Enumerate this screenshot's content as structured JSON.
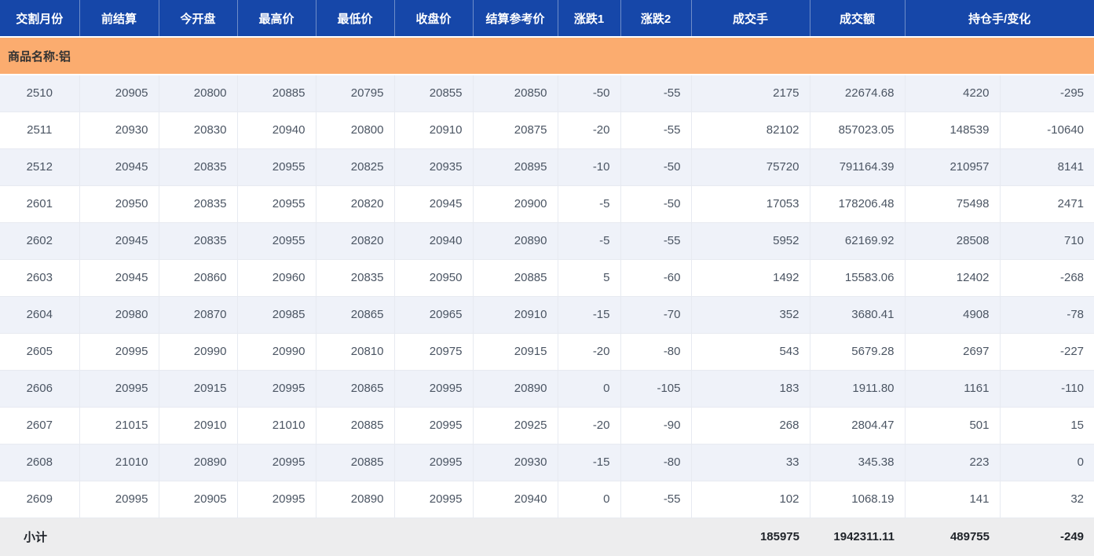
{
  "table": {
    "group_label": "商品名称:铝",
    "columns": [
      {
        "key": "month",
        "label": "交割月份"
      },
      {
        "key": "prev_settle",
        "label": "前结算"
      },
      {
        "key": "open",
        "label": "今开盘"
      },
      {
        "key": "high",
        "label": "最高价"
      },
      {
        "key": "low",
        "label": "最低价"
      },
      {
        "key": "close",
        "label": "收盘价"
      },
      {
        "key": "settle_ref",
        "label": "结算参考价"
      },
      {
        "key": "change1",
        "label": "涨跌1"
      },
      {
        "key": "change2",
        "label": "涨跌2"
      },
      {
        "key": "volume",
        "label": "成交手"
      },
      {
        "key": "turnover",
        "label": "成交额"
      },
      {
        "key": "oi_and_change",
        "label": "持仓手/变化",
        "span": 2
      }
    ],
    "rows": [
      [
        "2510",
        "20905",
        "20800",
        "20885",
        "20795",
        "20855",
        "20850",
        "-50",
        "-55",
        "2175",
        "22674.68",
        "4220",
        "-295"
      ],
      [
        "2511",
        "20930",
        "20830",
        "20940",
        "20800",
        "20910",
        "20875",
        "-20",
        "-55",
        "82102",
        "857023.05",
        "148539",
        "-10640"
      ],
      [
        "2512",
        "20945",
        "20835",
        "20955",
        "20825",
        "20935",
        "20895",
        "-10",
        "-50",
        "75720",
        "791164.39",
        "210957",
        "8141"
      ],
      [
        "2601",
        "20950",
        "20835",
        "20955",
        "20820",
        "20945",
        "20900",
        "-5",
        "-50",
        "17053",
        "178206.48",
        "75498",
        "2471"
      ],
      [
        "2602",
        "20945",
        "20835",
        "20955",
        "20820",
        "20940",
        "20890",
        "-5",
        "-55",
        "5952",
        "62169.92",
        "28508",
        "710"
      ],
      [
        "2603",
        "20945",
        "20860",
        "20960",
        "20835",
        "20950",
        "20885",
        "5",
        "-60",
        "1492",
        "15583.06",
        "12402",
        "-268"
      ],
      [
        "2604",
        "20980",
        "20870",
        "20985",
        "20865",
        "20965",
        "20910",
        "-15",
        "-70",
        "352",
        "3680.41",
        "4908",
        "-78"
      ],
      [
        "2605",
        "20995",
        "20990",
        "20990",
        "20810",
        "20975",
        "20915",
        "-20",
        "-80",
        "543",
        "5679.28",
        "2697",
        "-227"
      ],
      [
        "2606",
        "20995",
        "20915",
        "20995",
        "20865",
        "20995",
        "20890",
        "0",
        "-105",
        "183",
        "1911.80",
        "1161",
        "-110"
      ],
      [
        "2607",
        "21015",
        "20910",
        "21010",
        "20885",
        "20995",
        "20925",
        "-20",
        "-90",
        "268",
        "2804.47",
        "501",
        "15"
      ],
      [
        "2608",
        "21010",
        "20890",
        "20995",
        "20885",
        "20995",
        "20930",
        "-15",
        "-80",
        "33",
        "345.38",
        "223",
        "0"
      ],
      [
        "2609",
        "20995",
        "20905",
        "20995",
        "20890",
        "20995",
        "20940",
        "0",
        "-55",
        "102",
        "1068.19",
        "141",
        "32"
      ]
    ],
    "subtotal": {
      "label": "小计",
      "volume": "185975",
      "turnover": "1942311.11",
      "open_interest": "489755",
      "oi_change": "-249"
    }
  },
  "colors": {
    "header_bg": "#1647a9",
    "header_text": "#ffffff",
    "group_band_bg": "#fbac6f",
    "row_alt_bg": "#eff2f9",
    "row_bg": "#ffffff",
    "subtotal_bg": "#ededee",
    "cell_text": "#4b5563"
  }
}
